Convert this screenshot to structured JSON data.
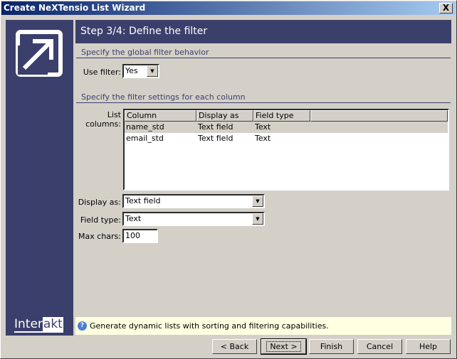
{
  "window": {
    "title": "Create NeXTensio List Wizard",
    "close": "X"
  },
  "brand": {
    "part1": "Inter",
    "part2": "akt"
  },
  "header": {
    "title": "Step 3/4: Define the filter"
  },
  "global_section": {
    "title": "Specify the global filter behavior",
    "use_filter_label": "Use filter:",
    "use_filter_value": "Yes"
  },
  "column_section": {
    "title": "Specify the filter settings for each column",
    "list_label": "List columns:",
    "headers": [
      "Column",
      "Display as",
      "Field type"
    ],
    "rows": [
      {
        "column": "name_std",
        "display_as": "Text field",
        "field_type": "Text"
      },
      {
        "column": "email_std",
        "display_as": "Text field",
        "field_type": "Text"
      }
    ],
    "display_as_label": "Display as:",
    "display_as_value": "Text field",
    "field_type_label": "Field type:",
    "field_type_value": "Text",
    "max_chars_label": "Max chars:",
    "max_chars_value": "100"
  },
  "info": {
    "text": "Generate dynamic lists with sorting and filtering capabilities.",
    "icon": "?"
  },
  "buttons": {
    "back": "< Back",
    "next": "Next >",
    "finish": "Finish",
    "cancel": "Cancel",
    "help": "Help"
  }
}
